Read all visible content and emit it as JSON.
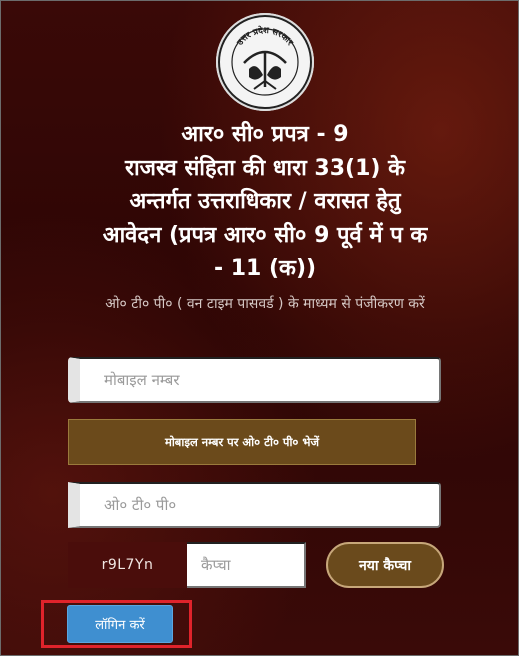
{
  "emblem": {
    "text": "उत्तर प्रदेश सरकार"
  },
  "form": {
    "title_lines": [
      "आर० सी० प्रपत्र - 9",
      "राजस्व संहिता की धारा 33(1) के",
      "अन्तर्गत उत्तराधिकार / वरासत हेतु",
      "आवेदन (प्रपत्र आर० सी० 9 पूर्व में प क",
      "- 11 (क))"
    ],
    "subtitle": "ओ० टी० पी० ( वन टाइम पासवर्ड ) के माध्यम से पंजीकरण करें",
    "mobile_placeholder": "मोबाइल नम्बर",
    "send_otp_label": "मोबाइल नम्बर पर ओ० टी० पी० भेजें",
    "otp_placeholder": "ओ० टी० पी०",
    "captcha_code": "r9L7Yn",
    "captcha_placeholder": "कैप्चा",
    "refresh_captcha_label": "नया कैप्चा",
    "login_label": "लॉगिन करें"
  },
  "colors": {
    "background": "#2c0504",
    "button_brown": "#6b4a1b",
    "login_blue": "#3f8fd0",
    "highlight_red": "#e0232b"
  }
}
